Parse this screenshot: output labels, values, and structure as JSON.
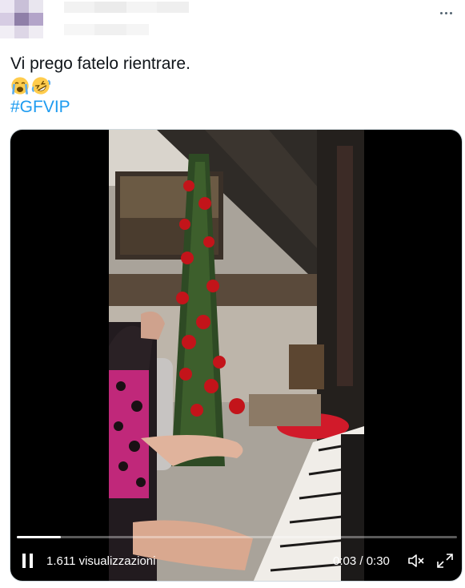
{
  "tweet": {
    "text": "Vi prego fatelo rientrare.",
    "emojis": [
      "loudly-crying-face-emoji",
      "rolling-on-floor-laughing-emoji"
    ],
    "hashtag": "#GFVIP"
  },
  "video": {
    "progress": 0.1,
    "views_label": "1.611 visualizzazioni",
    "time_label": "0:03 / 0:30",
    "state": "playing"
  },
  "colors": {
    "text": "#0f1419",
    "link": "#1d9bf0",
    "icon_gray": "#536471"
  }
}
